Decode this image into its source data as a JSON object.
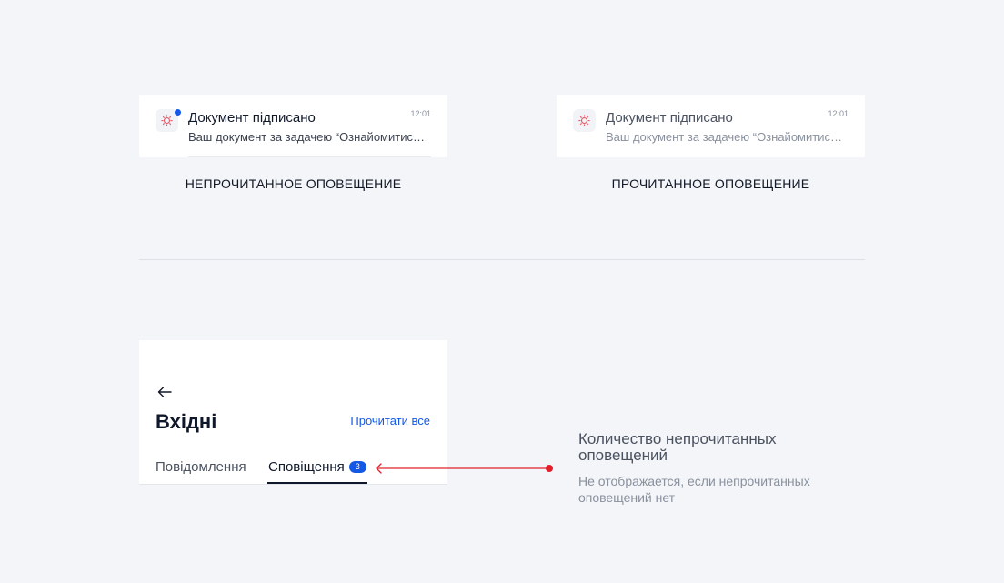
{
  "notifications": {
    "unread": {
      "title": "Документ підписано",
      "body": "Ваш документ за задачею “Ознайомитись з документом”",
      "time": "12:01",
      "caption": "НЕПРОЧИТАННОЕ ОПОВЕЩЕНИЕ"
    },
    "read": {
      "title": "Документ підписано",
      "body": "Ваш документ за задачею “Ознайомитись з документом”",
      "time": "12:01",
      "caption": "ПРОЧИТАННОЕ ОПОВЕЩЕНИЕ"
    }
  },
  "inbox": {
    "title": "Вхідні",
    "read_all": "Прочитати все",
    "tabs": [
      {
        "label": "Повідомлення"
      },
      {
        "label": "Сповіщення",
        "badge": "3"
      }
    ]
  },
  "annotation": {
    "title": "Количество непрочитанных оповещений",
    "subtitle": "Не отображается, если непрочитанных оповещений нет"
  },
  "colors": {
    "accent": "#1458e6",
    "pointer": "#e0202c",
    "background": "#f3f5f8"
  },
  "icons": {
    "app": "signature-seal-icon",
    "back": "arrow-left-icon"
  }
}
